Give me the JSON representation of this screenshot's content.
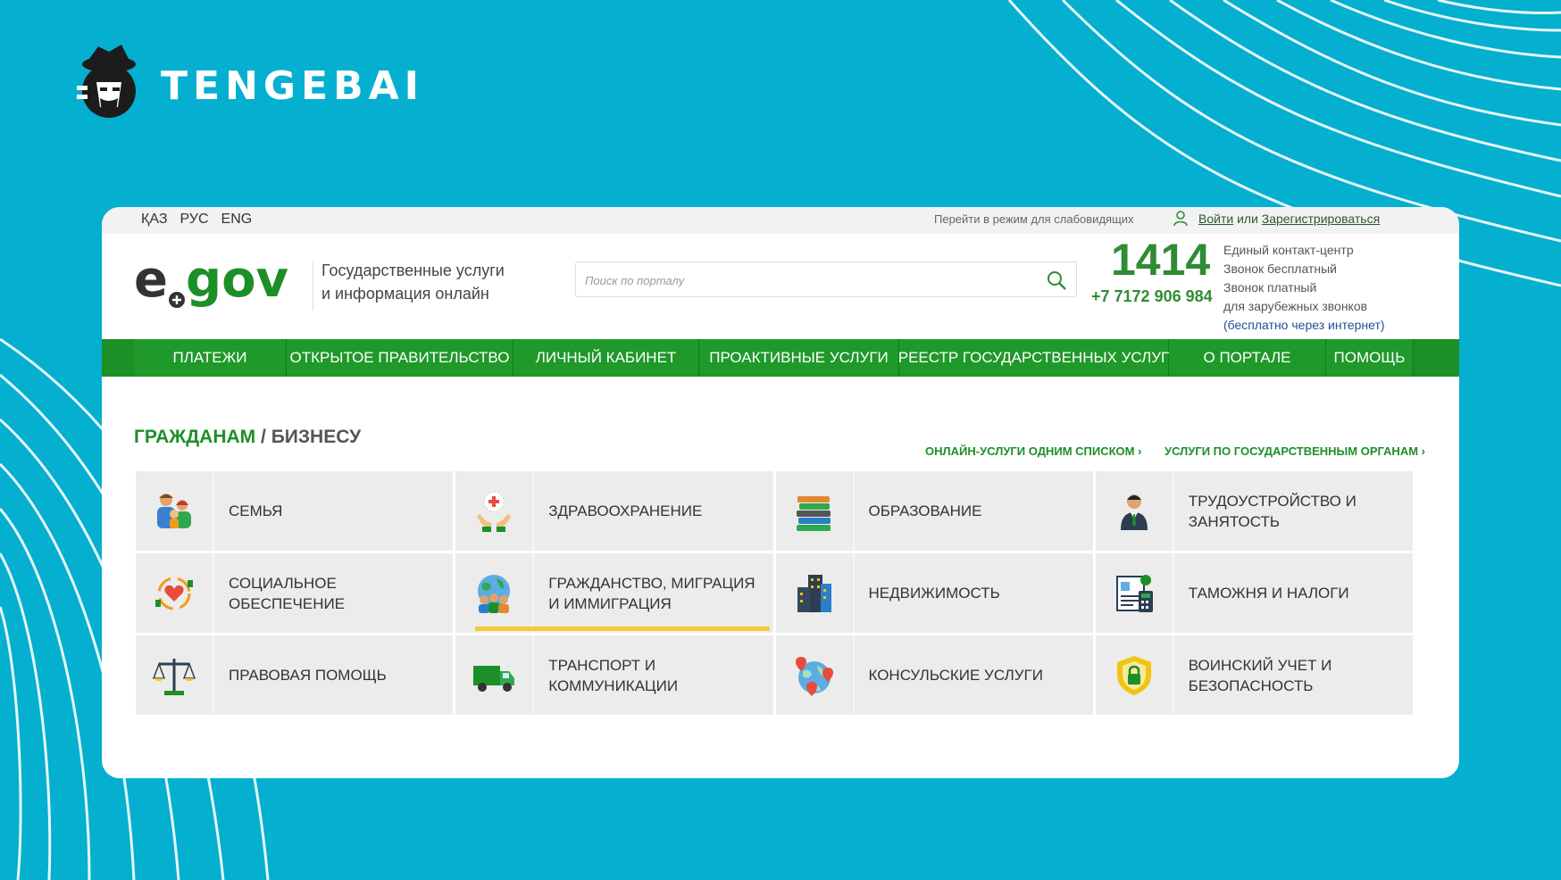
{
  "brand": {
    "name": "TENGEBAI"
  },
  "topbar": {
    "languages": [
      "ҚАЗ",
      "РУС",
      "ENG"
    ],
    "vision_mode": "Перейти в режим для слабовидящих",
    "login": "Войти",
    "or": "или",
    "register": "Зарегистрироваться"
  },
  "header": {
    "logo_text": "egov",
    "tagline_line1": "Государственные услуги",
    "tagline_line2": "и информация онлайн",
    "search_placeholder": "Поиск по порталу",
    "hotline": "1414",
    "phone": "+7 7172 906 984",
    "contact_line1": "Единый контакт-центр",
    "contact_line2": "Звонок бесплатный",
    "contact_line3": "Звонок платный",
    "contact_line4": "для зарубежных звонков",
    "contact_line5": "(бесплатно через интернет)"
  },
  "nav": [
    "ПЛАТЕЖИ",
    "ОТКРЫТОЕ ПРАВИТЕЛЬСТВО",
    "ЛИЧНЫЙ КАБИНЕТ",
    "ПРОАКТИВНЫЕ УСЛУГИ",
    "РЕЕСТР ГОСУДАРСТВЕННЫХ УСЛУГ",
    "О ПОРТАЛЕ",
    "ПОМОЩЬ"
  ],
  "section": {
    "title_part1": "ГРАЖДАНАМ",
    "title_sep": " / ",
    "title_part2": "БИЗНЕСУ",
    "link_all_services": "ОНЛАЙН-УСЛУГИ ОДНИМ СПИСКОМ ›",
    "link_by_agency": "УСЛУГИ ПО ГОСУДАРСТВЕННЫМ ОРГАНАМ ›"
  },
  "categories": [
    {
      "label": "СЕМЬЯ",
      "icon": "family-icon"
    },
    {
      "label": "ЗДРАВООХРАНЕНИЕ",
      "icon": "healthcare-icon"
    },
    {
      "label": "ОБРАЗОВАНИЕ",
      "icon": "books-icon"
    },
    {
      "label": "ТРУДОУСТРОЙСТВО И ЗАНЯТОСТЬ",
      "icon": "employee-icon"
    },
    {
      "label": "СОЦИАЛЬНОЕ ОБЕСПЕЧЕНИЕ",
      "icon": "social-heart-icon"
    },
    {
      "label": "ГРАЖДАНСТВО, МИГРАЦИЯ И ИММИГРАЦИЯ",
      "icon": "globe-people-icon",
      "active": true
    },
    {
      "label": "НЕДВИЖИМОСТЬ",
      "icon": "buildings-icon"
    },
    {
      "label": "ТАМОЖНЯ И НАЛОГИ",
      "icon": "tax-document-icon"
    },
    {
      "label": "ПРАВОВАЯ ПОМОЩЬ",
      "icon": "scales-icon"
    },
    {
      "label": "ТРАНСПОРТ И КОММУНИКАЦИИ",
      "icon": "truck-icon"
    },
    {
      "label": "КОНСУЛЬСКИЕ УСЛУГИ",
      "icon": "globe-pins-icon"
    },
    {
      "label": "ВОИНСКИЙ УЧЕТ И БЕЗОПАСНОСТЬ",
      "icon": "shield-lock-icon"
    }
  ],
  "colors": {
    "background": "#05afd0",
    "egov_green": "#1d8f27",
    "active_underline": "#f5c93b"
  }
}
